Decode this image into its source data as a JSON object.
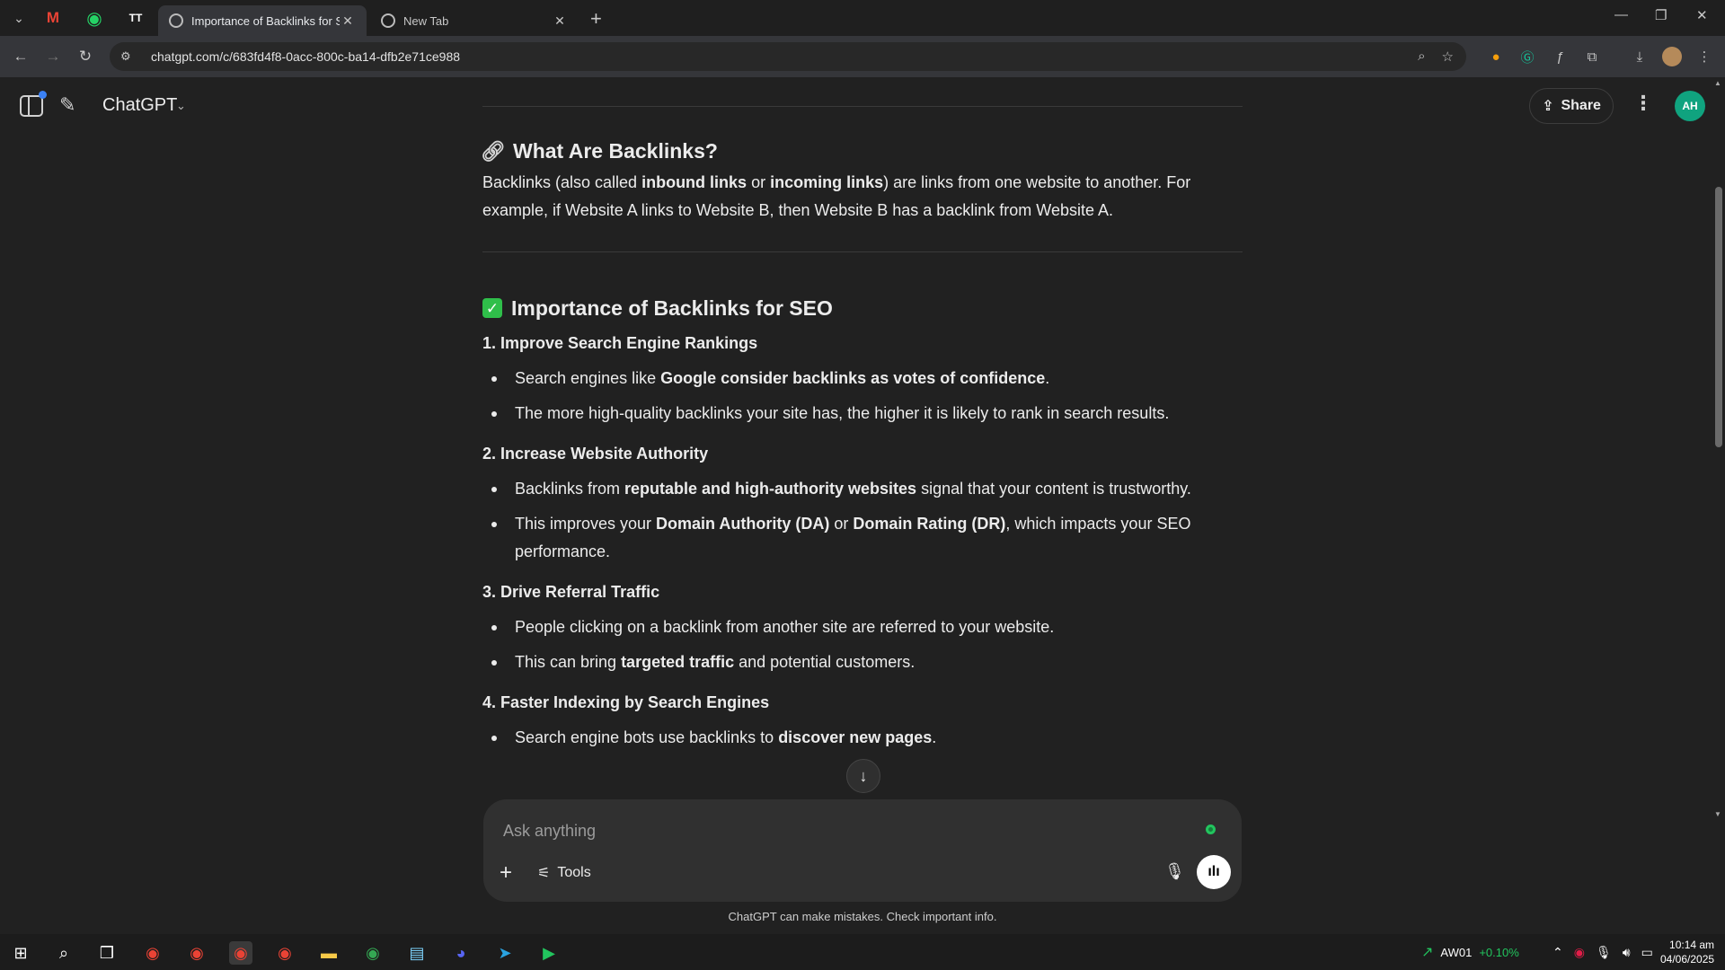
{
  "browser": {
    "pinned_tabs": [
      "Gmail",
      "WhatsApp",
      "TT"
    ],
    "tabs": [
      {
        "label": "Importance of Backlinks for SEO",
        "active": true
      },
      {
        "label": "New Tab",
        "active": false
      }
    ],
    "url": "chatgpt.com/c/683fd4f8-0acc-800c-ba14-dfb2e71ce988"
  },
  "app": {
    "model": "ChatGPT",
    "share_label": "Share",
    "avatar_initials": "AH"
  },
  "article": {
    "section1_title": "What Are Backlinks?",
    "section1_para": [
      {
        "text": "Backlinks (also called ",
        "b": false
      },
      {
        "text": "inbound links",
        "b": true
      },
      {
        "text": " or ",
        "b": false
      },
      {
        "text": "incoming links",
        "b": true
      },
      {
        "text": ") are links from one website to another. For example, if Website A links to Website B, then Website B has a backlink from Website A.",
        "b": false
      }
    ],
    "section2_title": "Importance of Backlinks for SEO",
    "points": [
      {
        "heading": "1. Improve Search Engine Rankings",
        "bullets": [
          [
            {
              "text": "Search engines like ",
              "b": false
            },
            {
              "text": "Google consider backlinks as votes of confidence",
              "b": true
            },
            {
              "text": ".",
              "b": false
            }
          ],
          [
            {
              "text": "The more high-quality backlinks your site has, the higher it is likely to rank in search results.",
              "b": false
            }
          ]
        ]
      },
      {
        "heading": "2. Increase Website Authority",
        "bullets": [
          [
            {
              "text": "Backlinks from ",
              "b": false
            },
            {
              "text": "reputable and high-authority websites",
              "b": true
            },
            {
              "text": " signal that your content is trustworthy.",
              "b": false
            }
          ],
          [
            {
              "text": "This improves your ",
              "b": false
            },
            {
              "text": "Domain Authority (DA)",
              "b": true
            },
            {
              "text": " or ",
              "b": false
            },
            {
              "text": "Domain Rating (DR)",
              "b": true
            },
            {
              "text": ", which impacts your SEO performance.",
              "b": false
            }
          ]
        ]
      },
      {
        "heading": "3. Drive Referral Traffic",
        "bullets": [
          [
            {
              "text": "People clicking on a backlink from another site are referred to your website.",
              "b": false
            }
          ],
          [
            {
              "text": "This can bring ",
              "b": false
            },
            {
              "text": "targeted traffic",
              "b": true
            },
            {
              "text": " and potential customers.",
              "b": false
            }
          ]
        ]
      },
      {
        "heading": "4. Faster Indexing by Search Engines",
        "bullets": [
          [
            {
              "text": "Search engine bots use backlinks to ",
              "b": false
            },
            {
              "text": "discover new pages",
              "b": true
            },
            {
              "text": ".",
              "b": false
            }
          ]
        ]
      }
    ]
  },
  "composer": {
    "placeholder": "Ask anything",
    "tools_label": "Tools"
  },
  "disclaimer": "ChatGPT can make mistakes. Check important info.",
  "taskbar": {
    "stock_name": "AW01",
    "stock_change": "+0.10%",
    "time": "10:14 am",
    "date": "04/06/2025"
  },
  "colors": {
    "accent_green": "#2fbf4a",
    "avatar_bg": "#10a37f",
    "stock_green": "#22c55e"
  }
}
